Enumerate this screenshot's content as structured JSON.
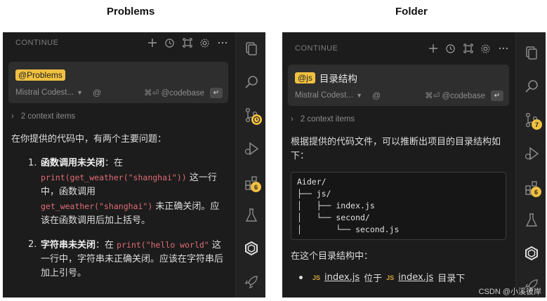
{
  "captions": {
    "left": "Problems",
    "right": "Folder"
  },
  "left": {
    "topbar_title": "CONTINUE",
    "pill": "@Problems",
    "model": "Mistral Codest...",
    "shortcut": "⌘⏎ @codebase",
    "context": "2 context items",
    "intro": "在你提供的代码中，有两个主要问题：",
    "items": [
      {
        "num": "1.",
        "bold": "函数调用未关闭",
        "t1": "：在",
        "code1": "print(get_weather(\"shanghai\"))",
        "t2": " 这一行中，函数调用",
        "code2": "get_weather(\"shanghai\")",
        "t3": " 未正确关闭。应该在函数调用后加上括号。"
      },
      {
        "num": "2.",
        "bold": "字符串未关闭",
        "t1": "：在",
        "code1": "print(\"hello world\"",
        "t2": "这一行中，字符串未正确关闭。应该在字符串后加上引号。"
      }
    ],
    "badges": {
      "history": "",
      "extensions": "6"
    }
  },
  "right": {
    "topbar_title": "CONTINUE",
    "pill": "@js",
    "prompt": "目录结构",
    "model": "Mistral Codest...",
    "shortcut": "⌘⏎ @codebase",
    "context": "2 context items",
    "intro": "根据提供的代码文件，可以推断出项目的目录结构如下：",
    "tree": "Aider/\n├── js/\n│   ├── index.js\n│   └── second/\n│       └── second.js",
    "after": "在这个目录结构中：",
    "bullet": {
      "tag": "JS",
      "file": "index.js",
      "mid": "位于",
      "tag2": "JS",
      "file2": "index.js",
      "end": "目录下"
    },
    "badges": {
      "source_control": "7",
      "extensions": "6"
    }
  },
  "watermark": "CSDN @小溪彼岸"
}
